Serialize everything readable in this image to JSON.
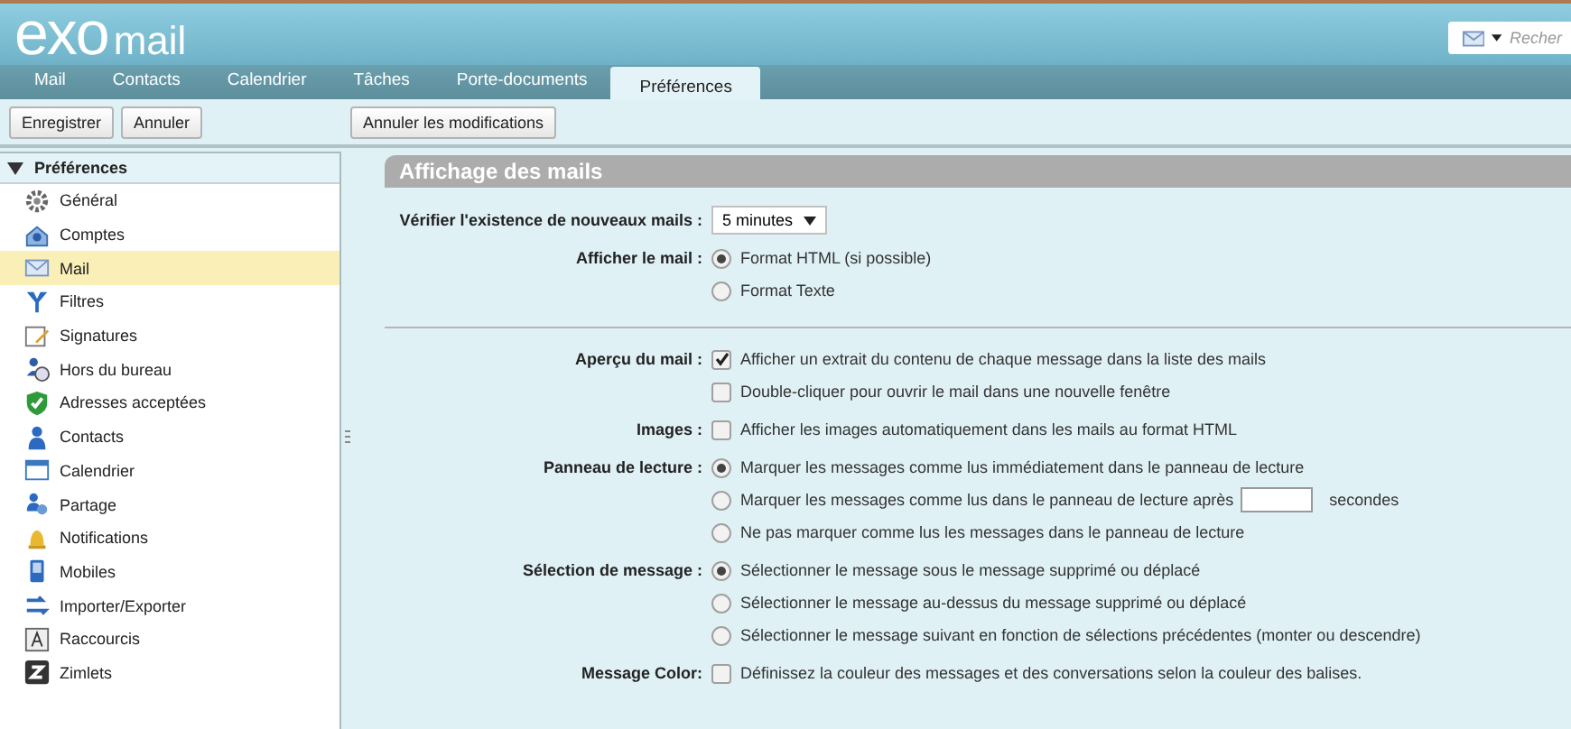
{
  "header": {
    "logo_main": "exo",
    "logo_sub": "mail",
    "search": {
      "placeholder": "Recher"
    }
  },
  "tabs": [
    {
      "label": "Mail",
      "selected": false
    },
    {
      "label": "Contacts",
      "selected": false
    },
    {
      "label": "Calendrier",
      "selected": false
    },
    {
      "label": "Tâches",
      "selected": false
    },
    {
      "label": "Porte-documents",
      "selected": false
    },
    {
      "label": "Préférences",
      "selected": true
    }
  ],
  "toolbar": {
    "left_buttons": [
      "Enregistrer",
      "Annuler"
    ],
    "right_buttons": [
      "Annuler les modifications"
    ]
  },
  "sidebar": {
    "title": "Préférences",
    "expanded": true,
    "items": [
      {
        "label": "Général",
        "selected": false
      },
      {
        "label": "Comptes",
        "selected": false
      },
      {
        "label": "Mail",
        "selected": true
      },
      {
        "label": "Filtres",
        "selected": false
      },
      {
        "label": "Signatures",
        "selected": false
      },
      {
        "label": "Hors du bureau",
        "selected": false
      },
      {
        "label": "Adresses acceptées",
        "selected": false
      },
      {
        "label": "Contacts",
        "selected": false
      },
      {
        "label": "Calendrier",
        "selected": false
      },
      {
        "label": "Partage",
        "selected": false
      },
      {
        "label": "Notifications",
        "selected": false
      },
      {
        "label": "Mobiles",
        "selected": false
      },
      {
        "label": "Importer/Exporter",
        "selected": false
      },
      {
        "label": "Raccourcis",
        "selected": false
      },
      {
        "label": "Zimlets",
        "selected": false
      }
    ]
  },
  "panel": {
    "title": "Affichage des mails",
    "sections": [
      {
        "groups": [
          {
            "label": "Vérifier l'existence de nouveaux mails :",
            "options": [
              {
                "kind": "select",
                "value": "5 minutes"
              }
            ]
          },
          {
            "label": "Afficher le mail :",
            "options": [
              {
                "kind": "radio",
                "label": "Format HTML (si possible)",
                "selected": true
              },
              {
                "kind": "radio",
                "label": "Format Texte",
                "selected": false
              }
            ]
          }
        ]
      },
      {
        "groups": [
          {
            "label": "Aperçu du mail :",
            "options": [
              {
                "kind": "checkbox",
                "label": "Afficher un extrait du contenu de chaque message dans la liste des mails",
                "checked": true
              },
              {
                "kind": "checkbox",
                "label": "Double-cliquer pour ouvrir le mail dans une nouvelle fenêtre",
                "checked": false
              }
            ]
          },
          {
            "label": "Images :",
            "options": [
              {
                "kind": "checkbox",
                "label": "Afficher les images automatiquement dans les mails au format HTML",
                "checked": false
              }
            ]
          },
          {
            "label": "Panneau de lecture :",
            "options": [
              {
                "kind": "radio",
                "label": "Marquer les messages comme lus immédiatement dans le panneau de lecture",
                "selected": true
              },
              {
                "kind": "radio",
                "label": "Marquer les messages comme lus dans le panneau de lecture après",
                "selected": false,
                "suffix": "secondes"
              },
              {
                "kind": "radio",
                "label": "Ne pas marquer comme lus les messages dans le panneau de lecture",
                "selected": false
              }
            ]
          },
          {
            "label": "Sélection de message :",
            "options": [
              {
                "kind": "radio",
                "label": "Sélectionner le message sous le message supprimé ou déplacé",
                "selected": true
              },
              {
                "kind": "radio",
                "label": "Sélectionner le message au-dessus du message supprimé ou déplacé",
                "selected": false
              },
              {
                "kind": "radio",
                "label": "Sélectionner le message suivant en fonction de sélections précédentes (monter ou descendre)",
                "selected": false
              }
            ]
          },
          {
            "label": "Message Color:",
            "options": [
              {
                "kind": "checkbox",
                "label": "Définissez la couleur des messages et des conversations selon la couleur des balises.",
                "checked": false
              }
            ]
          }
        ]
      }
    ]
  }
}
